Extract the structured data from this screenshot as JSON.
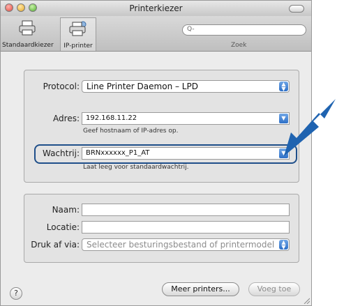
{
  "window": {
    "title": "Printerkiezer"
  },
  "toolbar": {
    "standard_label": "Standaardkiezer",
    "ip_label": "IP-printer",
    "search_placeholder": "Q-",
    "search_label": "Zoek"
  },
  "connection": {
    "protocol_label": "Protocol:",
    "protocol_value": "Line Printer Daemon – LPD",
    "address_label": "Adres:",
    "address_value": "192.168.11.22",
    "address_hint": "Geef hostnaam of IP-adres op.",
    "queue_label": "Wachtrij:",
    "queue_value": "BRNxxxxxx_P1_AT",
    "queue_hint": "Laat leeg voor standaardwachtrij."
  },
  "printer": {
    "name_label": "Naam:",
    "name_value": "",
    "location_label": "Locatie:",
    "location_value": "",
    "print_via_label": "Druk af via:",
    "print_via_value": "Selecteer besturingsbestand of printermodel"
  },
  "footer": {
    "help_label": "?",
    "more_printers_label": "Meer printers...",
    "add_label": "Voeg toe"
  },
  "colors": {
    "accent": "#1f6fc7",
    "arrow": "#1f63b0"
  }
}
